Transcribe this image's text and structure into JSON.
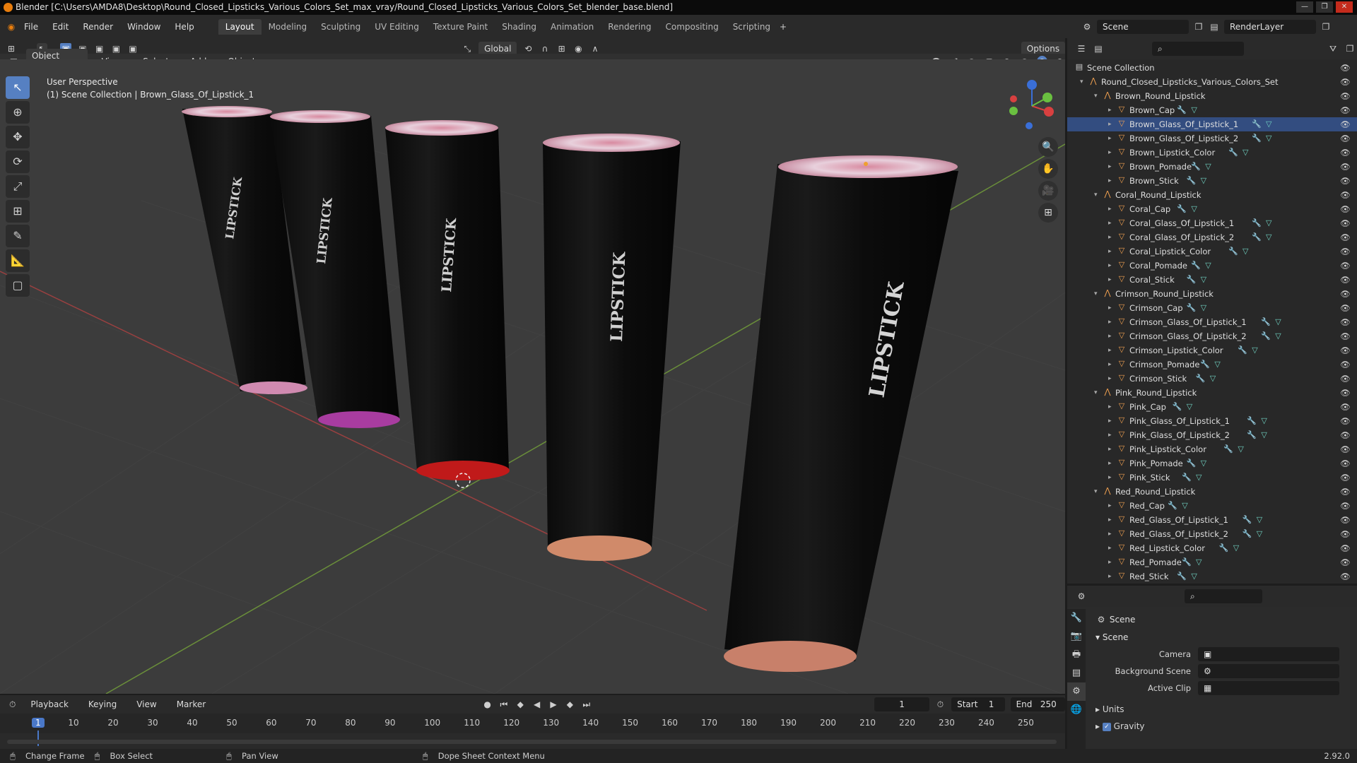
{
  "titlebar": {
    "title": "Blender [C:\\Users\\AMDA8\\Desktop\\Round_Closed_Lipsticks_Various_Colors_Set_max_vray/Round_Closed_Lipsticks_Various_Colors_Set_blender_base.blend]"
  },
  "menus": [
    "File",
    "Edit",
    "Render",
    "Window",
    "Help"
  ],
  "workspaces": [
    "Layout",
    "Modeling",
    "Sculpting",
    "UV Editing",
    "Texture Paint",
    "Shading",
    "Animation",
    "Rendering",
    "Compositing",
    "Scripting"
  ],
  "scene": {
    "name": "Scene",
    "layer": "RenderLayer"
  },
  "viewportHeader": {
    "mode": "Object Mode",
    "menus": [
      "View",
      "Select",
      "Add",
      "Object"
    ],
    "orientation": "Global",
    "options": "Options"
  },
  "viewportInfo": {
    "line1": "User Perspective",
    "line2": "(1) Scene Collection | Brown_Glass_Of_Lipstick_1"
  },
  "lipstick_label": "LIPSTICK",
  "outliner": {
    "root": "Scene Collection",
    "top": "Round_Closed_Lipsticks_Various_Colors_Set",
    "groups": [
      {
        "name": "Brown_Round_Lipstick",
        "items": [
          "Brown_Cap",
          "Brown_Glass_Of_Lipstick_1",
          "Brown_Glass_Of_Lipstick_2",
          "Brown_Lipstick_Color",
          "Brown_Pomade",
          "Brown_Stick"
        ]
      },
      {
        "name": "Coral_Round_Lipstick",
        "items": [
          "Coral_Cap",
          "Coral_Glass_Of_Lipstick_1",
          "Coral_Glass_Of_Lipstick_2",
          "Coral_Lipstick_Color",
          "Coral_Pomade",
          "Coral_Stick"
        ]
      },
      {
        "name": "Crimson_Round_Lipstick",
        "items": [
          "Crimson_Cap",
          "Crimson_Glass_Of_Lipstick_1",
          "Crimson_Glass_Of_Lipstick_2",
          "Crimson_Lipstick_Color",
          "Crimson_Pomade",
          "Crimson_Stick"
        ]
      },
      {
        "name": "Pink_Round_Lipstick",
        "items": [
          "Pink_Cap",
          "Pink_Glass_Of_Lipstick_1",
          "Pink_Glass_Of_Lipstick_2",
          "Pink_Lipstick_Color",
          "Pink_Pomade",
          "Pink_Stick"
        ]
      },
      {
        "name": "Red_Round_Lipstick",
        "items": [
          "Red_Cap",
          "Red_Glass_Of_Lipstick_1",
          "Red_Glass_Of_Lipstick_2",
          "Red_Lipstick_Color",
          "Red_Pomade",
          "Red_Stick"
        ]
      }
    ],
    "selected": "Brown_Glass_Of_Lipstick_1"
  },
  "properties": {
    "title": "Scene",
    "section": "Scene",
    "camera_label": "Camera",
    "bg_label": "Background Scene",
    "clip_label": "Active Clip",
    "units": "Units",
    "gravity": "Gravity"
  },
  "timeline": {
    "menus": [
      "Playback",
      "Keying",
      "View",
      "Marker"
    ],
    "current": "1",
    "start_label": "Start",
    "start": "1",
    "end_label": "End",
    "end": "250",
    "ticks": [
      "1",
      "10",
      "20",
      "30",
      "40",
      "50",
      "60",
      "70",
      "80",
      "90",
      "100",
      "110",
      "120",
      "130",
      "140",
      "150",
      "160",
      "170",
      "180",
      "190",
      "200",
      "210",
      "220",
      "230",
      "240",
      "250"
    ]
  },
  "statusbar": {
    "items": [
      "Change Frame",
      "Box Select",
      "Pan View",
      "Dope Sheet Context Menu"
    ],
    "version": "2.92.0"
  }
}
